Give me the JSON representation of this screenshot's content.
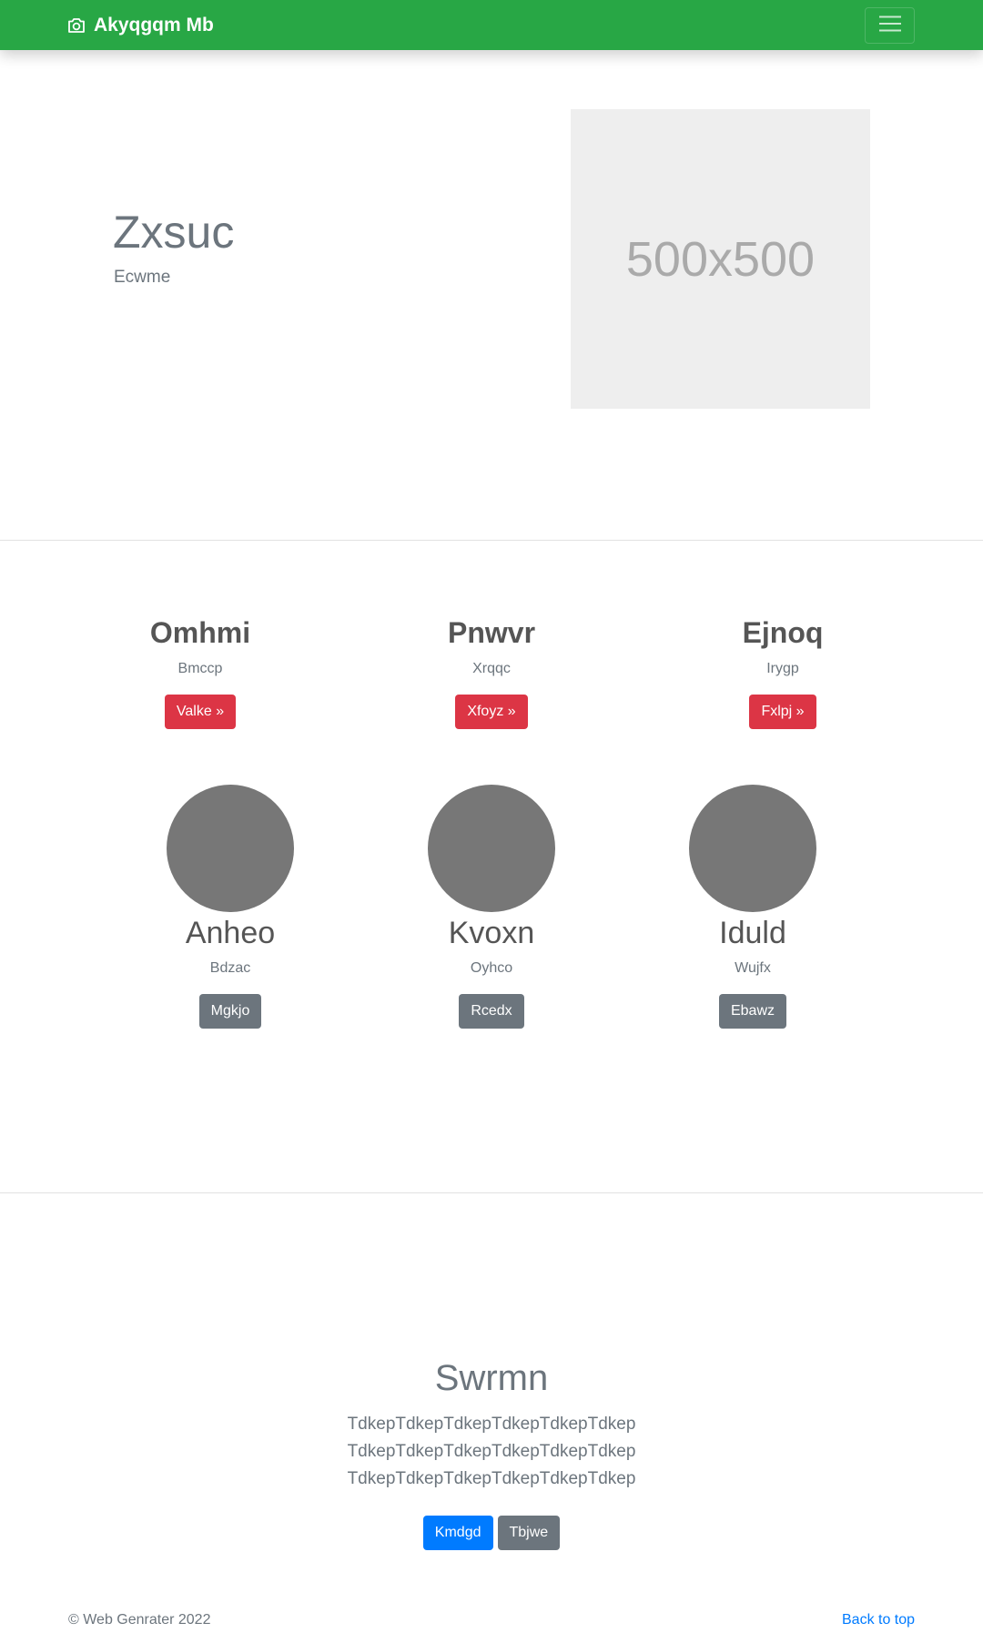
{
  "navbar": {
    "brand": "Akyqgqm Mb",
    "brand_color": "#28a745",
    "brand_icon": "camera-icon",
    "menu_icon": "hamburger-icon"
  },
  "hero": {
    "title": "Zxsuc",
    "subtitle": "Ecwme",
    "image_label": "500x500"
  },
  "features": [
    {
      "title": "Omhmi",
      "text": "Bmccp",
      "button": "Valke »"
    },
    {
      "title": "Pnwvr",
      "text": "Xrqqc",
      "button": "Xfoyz »"
    },
    {
      "title": "Ejnoq",
      "text": "Irygp",
      "button": "Fxlpj »"
    }
  ],
  "members": [
    {
      "name": "Anheo",
      "text": "Bdzac",
      "button": "Mgkjo"
    },
    {
      "name": "Kvoxn",
      "text": "Oyhco",
      "button": "Rcedx"
    },
    {
      "name": "Iduld",
      "text": "Wujfx",
      "button": "Ebawz"
    }
  ],
  "cta": {
    "title": "Swrmn",
    "text": "TdkepTdkepTdkepTdkepTdkepTdkep TdkepTdkepTdkepTdkepTdkepTdkep TdkepTdkepTdkepTdkepTdkepTdkep",
    "primary_button": "Kmdgd",
    "secondary_button": "Tbjwe"
  },
  "footer": {
    "copyright": "© Web Genrater 2022",
    "back_to_top": "Back to top"
  },
  "colors": {
    "danger": "#dc3545",
    "secondary": "#6c757d",
    "primary": "#007bff",
    "avatar": "#777777"
  }
}
